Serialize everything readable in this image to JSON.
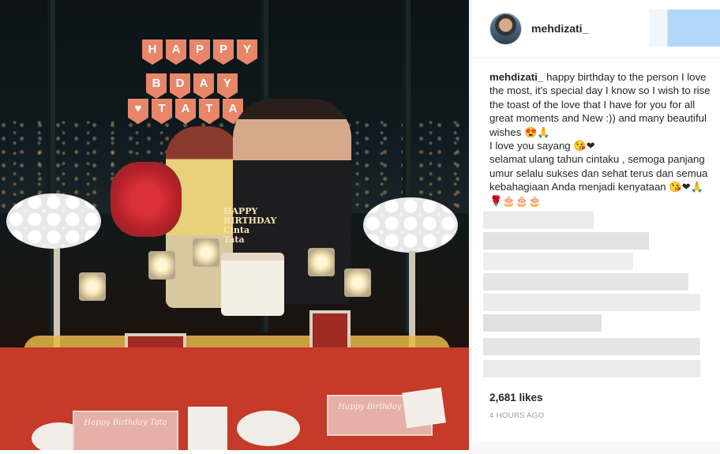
{
  "post": {
    "username": "mehdizati_",
    "caption_user": "mehdizati_",
    "caption_lines": [
      "happy birthday to the person I love the most, it's special day I know so I wish to rise the toast of the love that I have for you for all great moments and New :)) and many beautiful wishes 😍🙏",
      "I love you sayang 😘❤",
      "selamat ulang tahun cintaku , semoga panjang umur selalu sukses dan sehat terus dan semua kebahagiaan Anda menjadi kenyataan 😘❤🙏🌹🎂🎂🎂"
    ],
    "likes": "2,681 likes",
    "timestamp": "4 HOURS AGO"
  },
  "photo": {
    "banner_top": [
      "H",
      "A",
      "P",
      "P",
      "Y"
    ],
    "banner_mid": [
      "B",
      "D",
      "A",
      "Y"
    ],
    "banner_bottom": [
      "T",
      "A",
      "T",
      "A"
    ],
    "cake_topper": "HAPPY BIRTHDAY Cinta Tata",
    "card_text": "Happy Birthday Tata"
  },
  "colors": {
    "banner": "#e8866a",
    "tablecloth": "#c53a28",
    "username_text": "#262626",
    "timestamp_text": "#999999"
  }
}
